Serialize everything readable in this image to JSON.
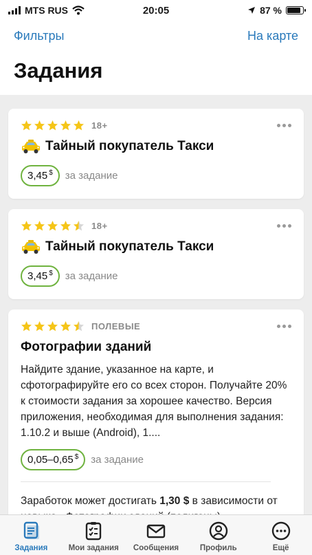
{
  "status_bar": {
    "carrier": "MTS RUS",
    "time": "20:05",
    "battery": "87 %",
    "battery_level": 0.87
  },
  "header": {
    "filters_label": "Фильтры",
    "map_label": "На карте",
    "title": "Задания"
  },
  "cards": [
    {
      "rating": 5,
      "meta": "18+",
      "title": "Тайный покупатель Такси",
      "price": "3,45",
      "currency": "$",
      "price_label": "за задание"
    },
    {
      "rating": 4.5,
      "meta": "18+",
      "title": "Тайный покупатель Такси",
      "price": "3,45",
      "currency": "$",
      "price_label": "за задание"
    },
    {
      "rating": 4.5,
      "meta": "ПОЛЕВЫЕ",
      "title": "Фотографии зданий",
      "description": "Найдите здание, указанное на карте, и сфотографируйте его со всех сторон. Получайте 20% к стоимости задания за хорошее качество. Версия приложения, необходимая для выполнения задания: 1.10.2 и выше (Android), 1....",
      "price": "0,05–0,65",
      "currency": "$",
      "price_label": "за задание",
      "earn_prefix": "Заработок может достигать ",
      "earn_amount": "1,30 $",
      "earn_suffix": " в зависимости от навыка «Фотографии зданий (полигоны)"
    }
  ],
  "tabs": [
    {
      "label": "Задания",
      "icon": "tasks-icon",
      "active": true
    },
    {
      "label": "Мои задания",
      "icon": "checklist-icon",
      "active": false
    },
    {
      "label": "Сообщения",
      "icon": "envelope-icon",
      "active": false
    },
    {
      "label": "Профиль",
      "icon": "profile-icon",
      "active": false
    },
    {
      "label": "Ещё",
      "icon": "more-icon",
      "active": false
    }
  ],
  "colors": {
    "accent": "#2a7abb",
    "star": "#f5c518",
    "price_border": "#6fb33f"
  }
}
